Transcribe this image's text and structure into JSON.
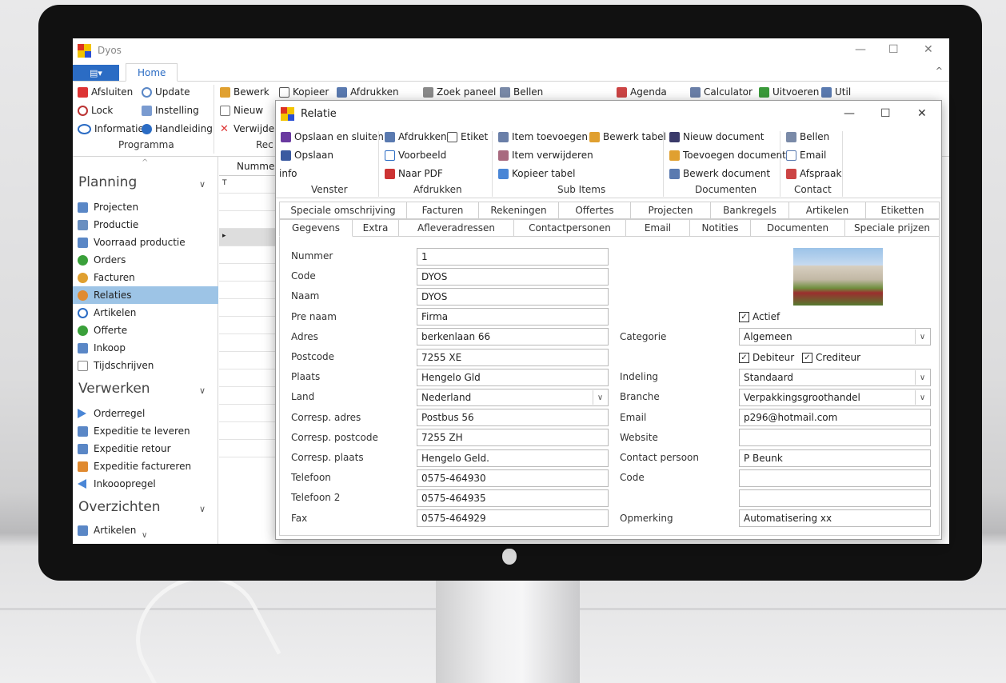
{
  "app": {
    "title": "Dyos",
    "menu_label": "▤▾",
    "home_tab": "Home"
  },
  "ribbon": {
    "programma": {
      "items": [
        "Afsluiten",
        "Update",
        "Lock",
        "Instelling",
        "Informatie",
        "Handleiding"
      ],
      "group": "Programma"
    },
    "record": {
      "items": [
        "Bewerk",
        "Kopieer",
        "Afdrukken",
        "Nieuw",
        "Verwijder"
      ],
      "group": "Rec"
    },
    "other": [
      "Zoek paneel",
      "Bellen",
      "Agenda",
      "Calculator",
      "Uitvoeren",
      "Util"
    ]
  },
  "sidebar": {
    "planning": {
      "title": "Planning",
      "items": [
        "Projecten",
        "Productie",
        "Voorraad productie",
        "Orders",
        "Facturen",
        "Relaties",
        "Artikelen",
        "Offerte",
        "Inkoop",
        "Tijdschrijven"
      ]
    },
    "verwerken": {
      "title": "Verwerken",
      "items": [
        "Orderregel",
        "Expeditie te leveren",
        "Expeditie retour",
        "Expeditie factureren",
        "Inkooopregel"
      ]
    },
    "overzichten": {
      "title": "Overzichten",
      "items": [
        "Artikelen"
      ]
    }
  },
  "grid": {
    "column": "Nummer"
  },
  "dialog": {
    "title": "Relatie",
    "venster": {
      "items": [
        "Opslaan en sluiten",
        "Opslaan",
        "info"
      ],
      "group": "Venster"
    },
    "afdrukken": {
      "items": [
        "Afdrukken",
        "Etiket",
        "Voorbeeld",
        "Naar PDF"
      ],
      "group": "Afdrukken"
    },
    "subitems": {
      "items": [
        "Item toevoegen",
        "Bewerk tabel",
        "Item verwijderen",
        "Kopieer tabel"
      ],
      "group": "Sub Items"
    },
    "documenten": {
      "items": [
        "Nieuw document",
        "Toevoegen document",
        "Bewerk document"
      ],
      "group": "Documenten"
    },
    "contact": {
      "items": [
        "Bellen",
        "Email",
        "Afspraak"
      ],
      "group": "Contact"
    },
    "tabs_row1": [
      "Speciale omschrijving",
      "Facturen",
      "Rekeningen",
      "Offertes",
      "Projecten",
      "Bankregels",
      "Artikelen",
      "Etiketten"
    ],
    "tabs_row2": [
      "Gegevens",
      "Extra",
      "Afleveradressen",
      "Contactpersonen",
      "Email",
      "Notities",
      "Documenten",
      "Speciale prijzen"
    ],
    "form_left": [
      {
        "label": "Nummer",
        "value": "1"
      },
      {
        "label": "Code",
        "value": "DYOS"
      },
      {
        "label": "Naam",
        "value": "DYOS"
      },
      {
        "label": "Pre naam",
        "value": "Firma"
      },
      {
        "label": "Adres",
        "value": "berkenlaan 66"
      },
      {
        "label": "Postcode",
        "value": "7255 XE"
      },
      {
        "label": "Plaats",
        "value": "Hengelo Gld"
      },
      {
        "label": "Land",
        "value": "Nederland"
      },
      {
        "label": "Corresp. adres",
        "value": "Postbus 56"
      },
      {
        "label": "Corresp. postcode",
        "value": "7255 ZH"
      },
      {
        "label": "Corresp. plaats",
        "value": "Hengelo Geld."
      },
      {
        "label": "Telefoon",
        "value": "0575-464930"
      },
      {
        "label": "Telefoon 2",
        "value": "0575-464935"
      },
      {
        "label": "Fax",
        "value": "0575-464929"
      }
    ],
    "form_right": {
      "actief": "Actief",
      "categorie": {
        "label": "Categorie",
        "value": "Algemeen"
      },
      "debiteur": "Debiteur",
      "crediteur": "Crediteur",
      "indeling": {
        "label": "Indeling",
        "value": "Standaard"
      },
      "branche": {
        "label": "Branche",
        "value": "Verpakkingsgroothandel"
      },
      "email": {
        "label": "Email",
        "value": "p296@hotmail.com"
      },
      "website": {
        "label": "Website",
        "value": ""
      },
      "contact": {
        "label": "Contact persoon",
        "value": "P Beunk"
      },
      "code": {
        "label": "Code",
        "value": ""
      },
      "extra": {
        "value": ""
      },
      "opmerking": {
        "label": "Opmerking",
        "value": "Automatisering xx"
      }
    }
  },
  "colors": {
    "accent": "#2b6cc4",
    "selection": "#9dc4e6"
  }
}
